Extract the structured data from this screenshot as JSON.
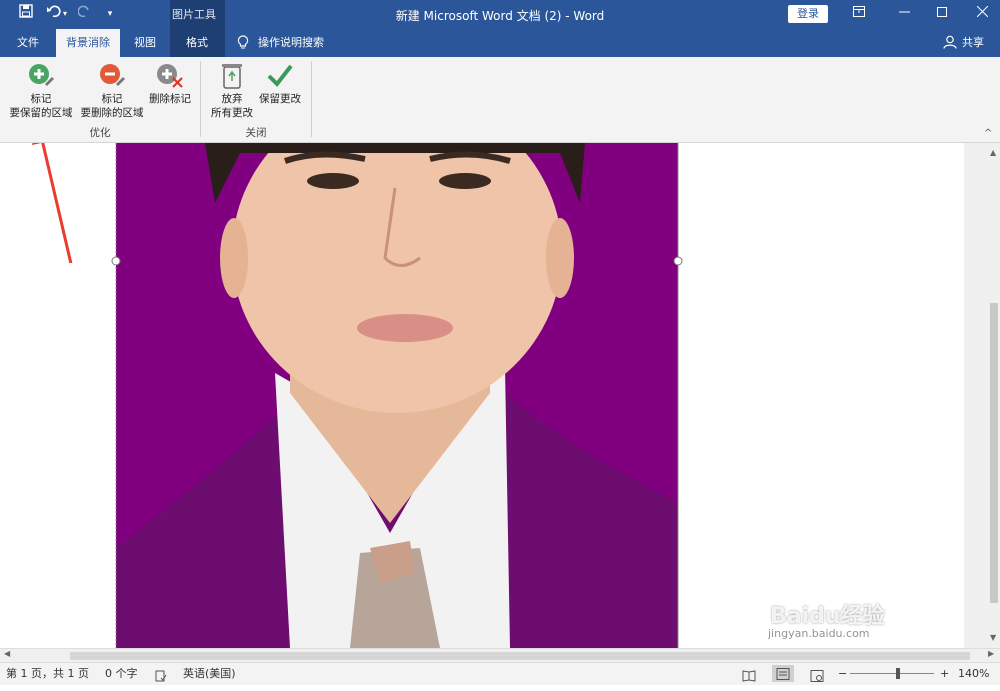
{
  "titlebar": {
    "title": "新建 Microsoft Word 文档 (2)  -  Word",
    "context_group": "图片工具",
    "login": "登录"
  },
  "tabs": {
    "file": "文件",
    "background_removal": "背景消除",
    "view": "视图",
    "format": "格式",
    "tell_me": "操作说明搜索",
    "share": "共享"
  },
  "ribbon": {
    "mark_keep_line1": "标记",
    "mark_keep_line2": "要保留的区域",
    "mark_remove_line1": "标记",
    "mark_remove_line2": "要删除的区域",
    "delete_mark": "删除标记",
    "discard_line1": "放弃",
    "discard_line2": "所有更改",
    "keep_changes": "保留更改",
    "group_refine": "优化",
    "group_close": "关闭"
  },
  "statusbar": {
    "page": "第 1 页，共 1 页",
    "words": "0 个字",
    "language": "英语(美国)",
    "zoom": "140%"
  },
  "watermark": {
    "text": "Baidu经验",
    "url": "jingyan.baidu.com"
  },
  "colors": {
    "accent": "#2b579a",
    "photo_background": "#800080",
    "arrow": "#ea3b2e"
  }
}
